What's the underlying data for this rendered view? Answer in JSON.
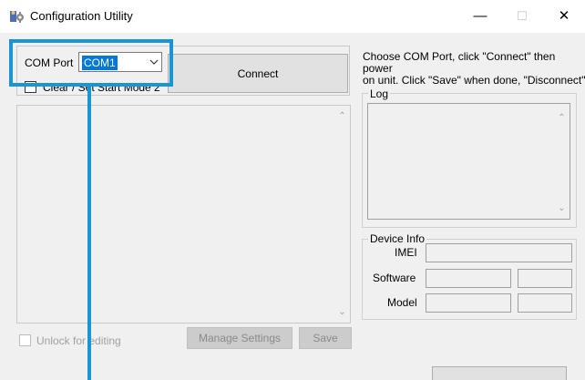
{
  "window": {
    "title": "Configuration Utility",
    "minimize_glyph": "—",
    "maximize_glyph": "☐",
    "close_glyph": "✕"
  },
  "com_port": {
    "label": "COM Port",
    "selected": "COM1"
  },
  "connect_button": "Connect",
  "clear_checkbox_label": "Clear / Set Start Mode 2",
  "instructions": {
    "line1": "Choose COM Port, click \"Connect\" then power",
    "line2": "on unit.  Click \"Save\" when done, \"Disconnect\""
  },
  "log": {
    "legend": "Log"
  },
  "device_info": {
    "legend": "Device Info",
    "imei_label": "IMEI",
    "software_label": "Software",
    "model_label": "Model"
  },
  "unlock_label": "Unlock for editing",
  "manage_settings_button": "Manage Settings",
  "save_button": "Save",
  "icons": {
    "app": "gear-people-icon",
    "dropdown": "chevron-down-icon",
    "scroll_up": "scroll-up-arrow-icon",
    "scroll_down": "scroll-down-arrow-icon"
  },
  "colors": {
    "highlight": "#1895d2",
    "selection": "#0078d7",
    "window_bg": "#f0f0f0"
  }
}
